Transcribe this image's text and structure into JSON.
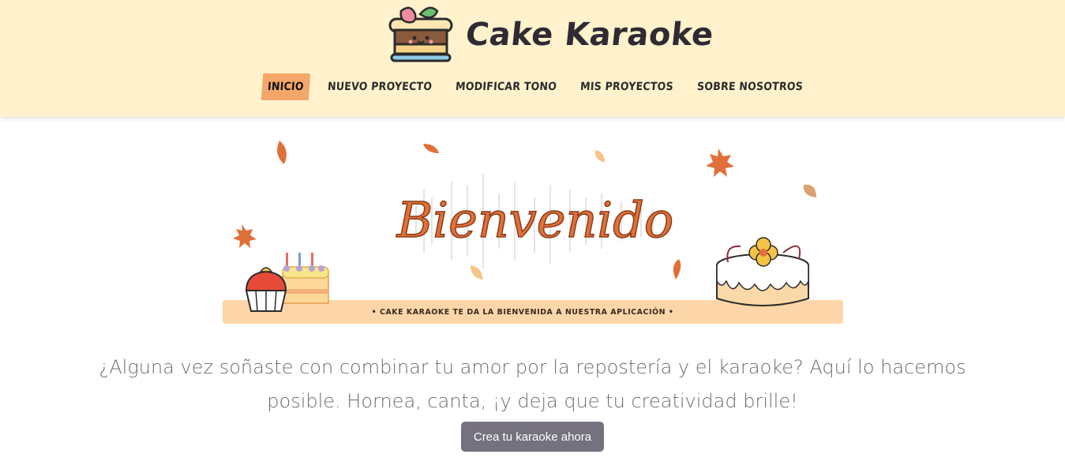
{
  "brand": {
    "name": "Cake Karaoke"
  },
  "nav": [
    {
      "label": "INICIO",
      "active": true
    },
    {
      "label": "NUEVO PROYECTO",
      "active": false
    },
    {
      "label": "MODIFICAR TONO",
      "active": false
    },
    {
      "label": "MIS PROYECTOS",
      "active": false
    },
    {
      "label": "SOBRE NOSOTROS",
      "active": false
    }
  ],
  "banner": {
    "title": "Bienvenido",
    "tagline": "• CAKE KARAOKE TE DA LA BIENVENIDA A NUESTRA APLICACIÓN •"
  },
  "main": {
    "lead": "¿Alguna vez soñaste con combinar tu amor por la repostería y el karaoke? Aquí lo hacemos posible. Hornea, canta, ¡y deja que tu creatividad brille!",
    "cta_label": "Crea tu karaoke ahora"
  },
  "colors": {
    "header_bg": "#fff2cc",
    "nav_active": "#f5a66a",
    "banner_strip": "#fcd6a8",
    "title_orange": "#e0703a",
    "cta_bg": "#75717f"
  }
}
